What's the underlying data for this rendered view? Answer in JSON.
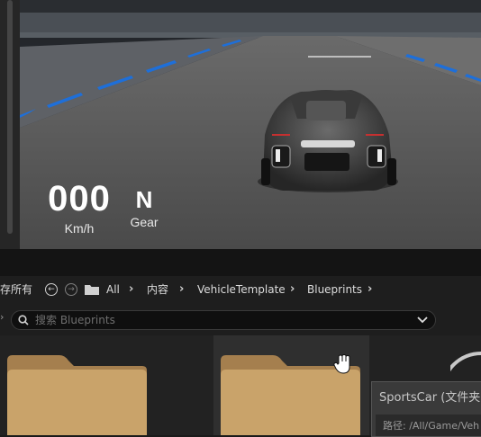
{
  "hud": {
    "speed": "000",
    "speed_unit": "Km/h",
    "gear": "N",
    "gear_label": "Gear"
  },
  "toolbar": {
    "save_all_label": "存所有",
    "back_icon": "arrow-left-circle",
    "forward_icon": "arrow-right-circle",
    "folder_icon": "folder",
    "breadcrumbs": [
      "All",
      "内容",
      "VehicleTemplate",
      "Blueprints"
    ]
  },
  "search": {
    "placeholder": "搜索 Blueprints"
  },
  "tooltip": {
    "title": "SportsCar (文件夹",
    "path": "路径: /All/Game/Veh"
  },
  "colors": {
    "folder": "#c9a36a",
    "accent_blue": "#1e6fd9",
    "panel_bg": "#1e1e1e"
  }
}
